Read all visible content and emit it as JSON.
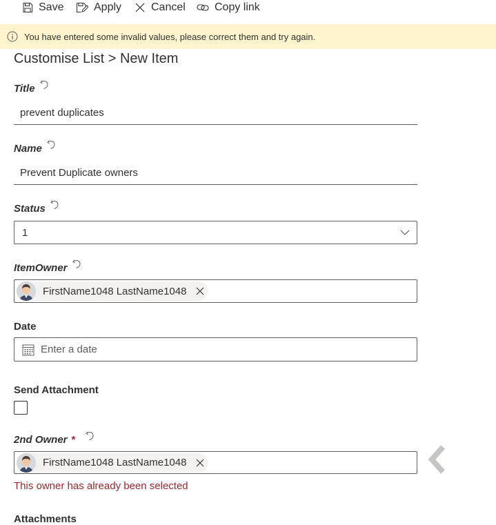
{
  "toolbar": {
    "save": "Save",
    "apply": "Apply",
    "cancel": "Cancel",
    "copy_link": "Copy link"
  },
  "banner": {
    "message": "You have entered some invalid values, please correct them and try again."
  },
  "breadcrumb": "Customise List > New Item",
  "fields": {
    "title": {
      "label": "Title",
      "value": "prevent duplicates"
    },
    "name": {
      "label": "Name",
      "value": "Prevent Duplicate owners"
    },
    "status": {
      "label": "Status",
      "value": "1"
    },
    "item_owner": {
      "label": "ItemOwner",
      "person": "FirstName1048 LastName1048"
    },
    "date": {
      "label": "Date",
      "placeholder": "Enter a date"
    },
    "send_attachment": {
      "label": "Send Attachment",
      "checked": false
    },
    "second_owner": {
      "label": "2nd Owner",
      "required_mark": "*",
      "person": "FirstName1048 LastName1048",
      "error": "This owner has already been selected"
    },
    "attachments": {
      "label": "Attachments"
    }
  },
  "colors": {
    "banner_bg": "#fff4ce",
    "error": "#a4262c",
    "border": "#605e5c",
    "text": "#323130"
  },
  "icons": {
    "save": "save-icon",
    "apply": "apply-icon",
    "cancel": "close-icon",
    "copy_link": "link-icon",
    "info": "info-icon",
    "undo": "undo-icon",
    "chevron": "chevron-down-icon",
    "calendar": "calendar-icon",
    "remove": "remove-icon",
    "side": "chevron-left-icon"
  }
}
